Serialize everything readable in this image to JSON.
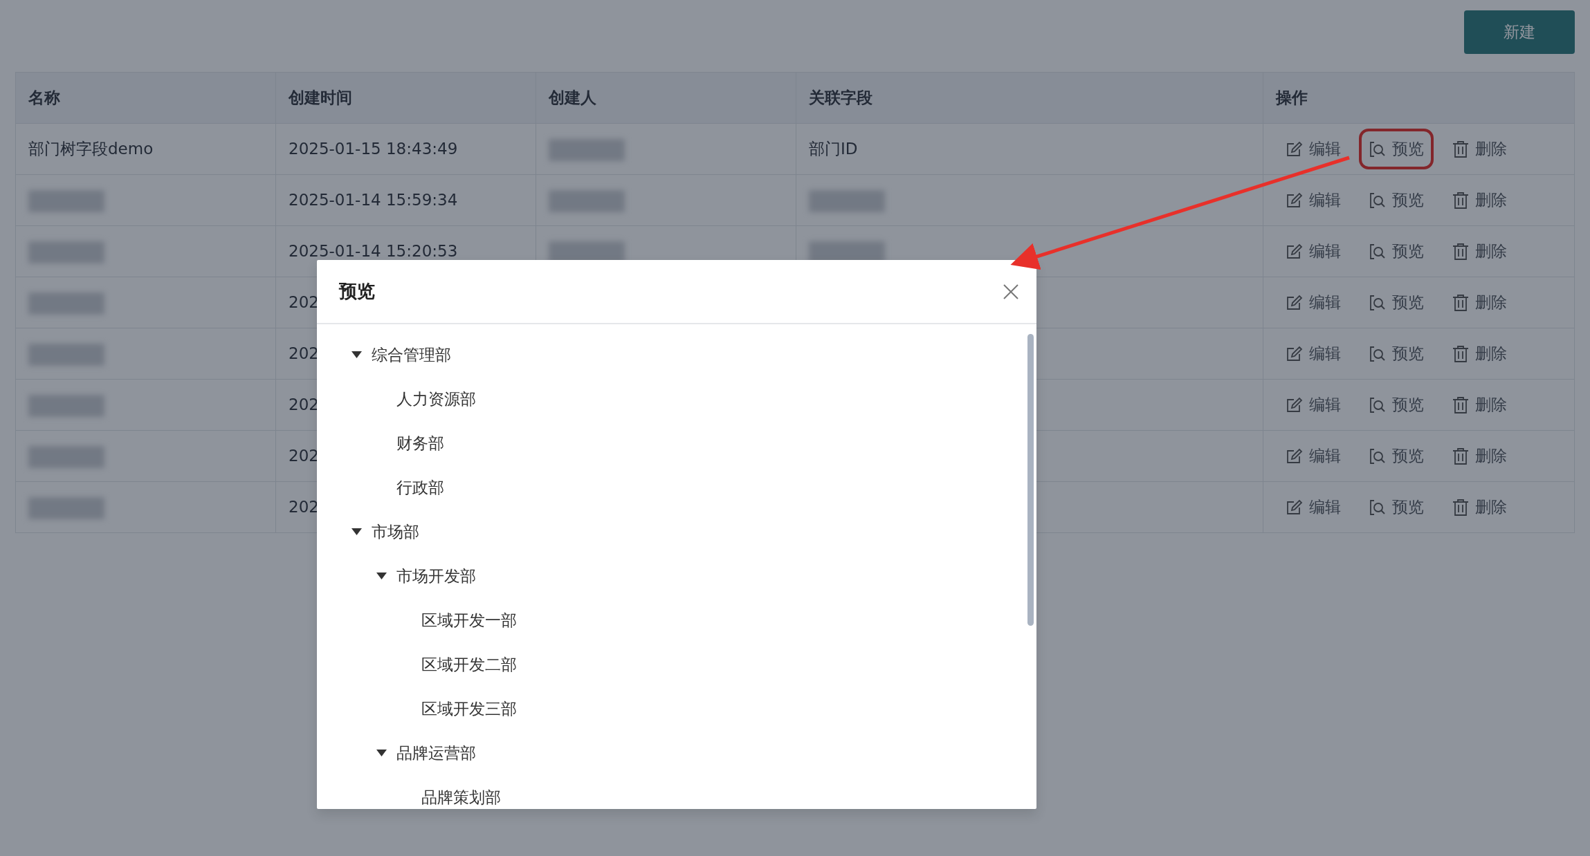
{
  "toolbar": {
    "new_button": "新建"
  },
  "table": {
    "columns": [
      "名称",
      "创建时间",
      "创建人",
      "关联字段",
      "操作"
    ],
    "rows": [
      {
        "name": {
          "text": "部门树字段demo"
        },
        "time": "2025-01-15 18:43:49",
        "creator": {
          "redacted": true
        },
        "field": {
          "text": "部门ID"
        },
        "actions": [
          {
            "kind": "edit",
            "label": "编辑",
            "highlighted": false
          },
          {
            "kind": "preview",
            "label": "预览",
            "highlighted": true
          },
          {
            "kind": "delete",
            "label": "删除",
            "highlighted": false
          }
        ]
      },
      {
        "name": {
          "redacted": true
        },
        "time": "2025-01-14 15:59:34",
        "creator": {
          "redacted": true
        },
        "field": {
          "redacted": true
        },
        "actions": [
          {
            "kind": "edit",
            "label": "编辑",
            "highlighted": false
          },
          {
            "kind": "preview",
            "label": "预览",
            "highlighted": false
          },
          {
            "kind": "delete",
            "label": "删除",
            "highlighted": false
          }
        ]
      },
      {
        "name": {
          "redacted": true
        },
        "time": "2025-01-14 15:20:53",
        "creator": {
          "redacted": true
        },
        "field": {
          "redacted": true
        },
        "actions": [
          {
            "kind": "edit",
            "label": "编辑",
            "highlighted": false
          },
          {
            "kind": "preview",
            "label": "预览",
            "highlighted": false
          },
          {
            "kind": "delete",
            "label": "删除",
            "highlighted": false
          }
        ]
      },
      {
        "name": {
          "redacted": true
        },
        "time": "202",
        "actions": [
          {
            "kind": "edit",
            "label": "编辑",
            "highlighted": false
          },
          {
            "kind": "preview",
            "label": "预览",
            "highlighted": false
          },
          {
            "kind": "delete",
            "label": "删除",
            "highlighted": false
          }
        ]
      },
      {
        "name": {
          "redacted": true
        },
        "time": "202",
        "actions": [
          {
            "kind": "edit",
            "label": "编辑",
            "highlighted": false
          },
          {
            "kind": "preview",
            "label": "预览",
            "highlighted": false
          },
          {
            "kind": "delete",
            "label": "删除",
            "highlighted": false
          }
        ]
      },
      {
        "name": {
          "redacted": true
        },
        "time": "202",
        "actions": [
          {
            "kind": "edit",
            "label": "编辑",
            "highlighted": false
          },
          {
            "kind": "preview",
            "label": "预览",
            "highlighted": false
          },
          {
            "kind": "delete",
            "label": "删除",
            "highlighted": false
          }
        ]
      },
      {
        "name": {
          "redacted": true
        },
        "time": "202",
        "actions": [
          {
            "kind": "edit",
            "label": "编辑",
            "highlighted": false
          },
          {
            "kind": "preview",
            "label": "预览",
            "highlighted": false
          },
          {
            "kind": "delete",
            "label": "删除",
            "highlighted": false
          }
        ]
      },
      {
        "name": {
          "redacted": true
        },
        "time": "202",
        "actions": [
          {
            "kind": "edit",
            "label": "编辑",
            "highlighted": false
          },
          {
            "kind": "preview",
            "label": "预览",
            "highlighted": false
          },
          {
            "kind": "delete",
            "label": "删除",
            "highlighted": false
          }
        ]
      }
    ]
  },
  "modal": {
    "title": "预览",
    "tree": [
      {
        "label": "综合管理部",
        "expanded": true,
        "children": [
          {
            "label": "人力资源部"
          },
          {
            "label": "财务部"
          },
          {
            "label": "行政部"
          }
        ]
      },
      {
        "label": "市场部",
        "expanded": true,
        "children": [
          {
            "label": "市场开发部",
            "expanded": true,
            "children": [
              {
                "label": "区域开发一部"
              },
              {
                "label": "区域开发二部"
              },
              {
                "label": "区域开发三部"
              }
            ]
          },
          {
            "label": "品牌运营部",
            "expanded": true,
            "children": [
              {
                "label": "品牌策划部"
              }
            ]
          }
        ]
      }
    ]
  }
}
